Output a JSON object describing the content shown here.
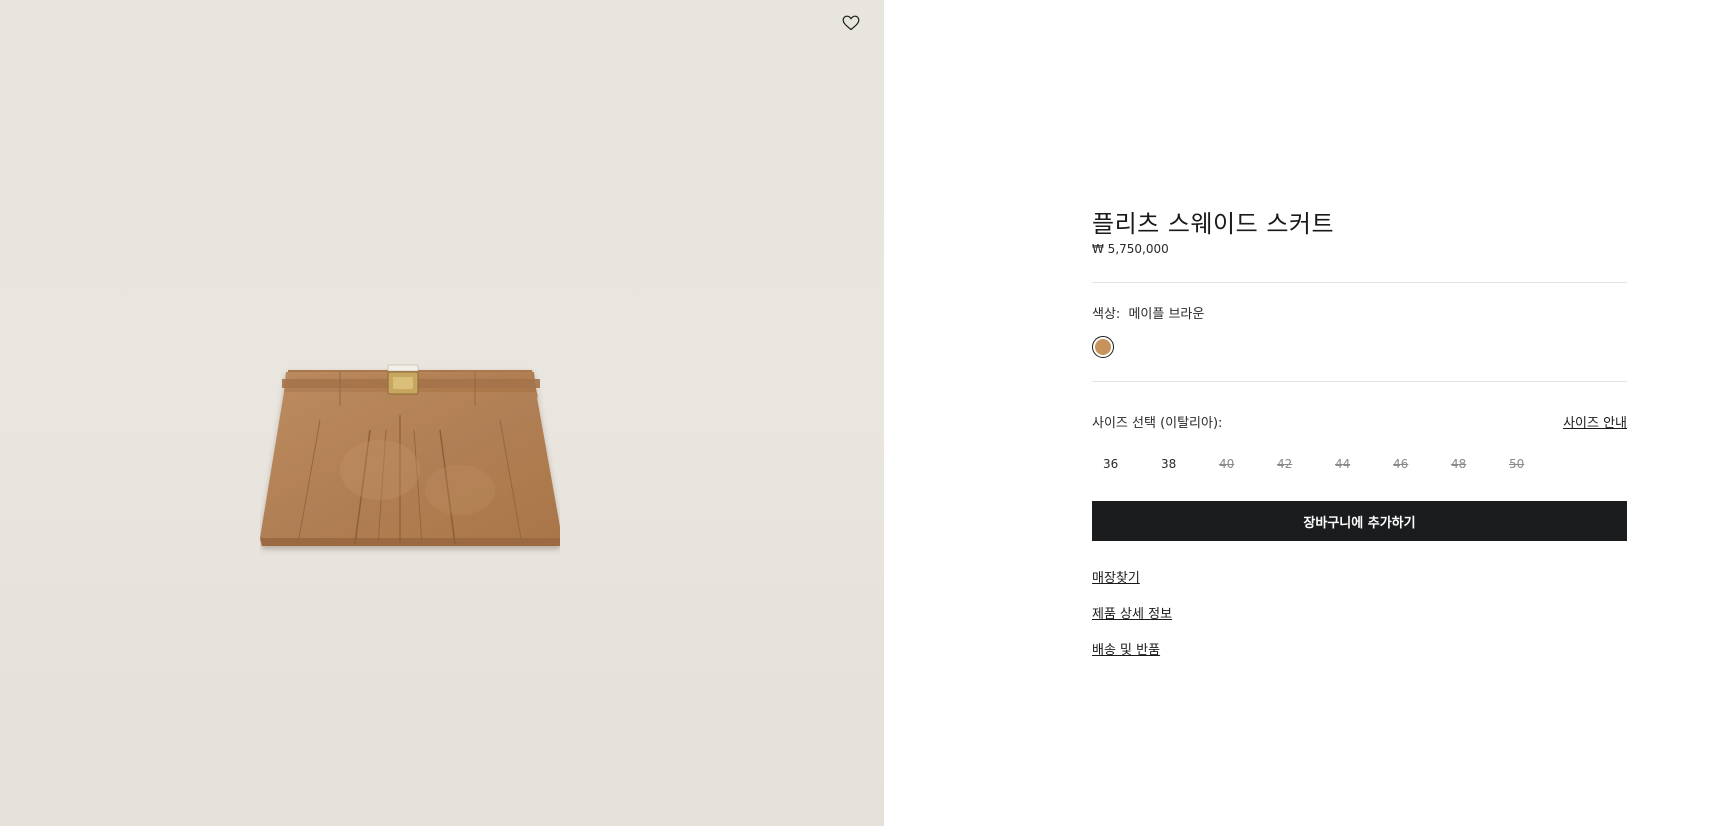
{
  "product": {
    "title": "플리츠 스웨이드 스커트",
    "price": "₩ 5,750,000",
    "image_icon": "suede-pleated-mini-skirt"
  },
  "wishlist": {
    "icon": "heart-outline-icon"
  },
  "color": {
    "label": "색상:",
    "value": "메이플 브라운",
    "swatch_hex": "#c8925b"
  },
  "size": {
    "label": "사이즈 선택 (이탈리아):",
    "guide_label": "사이즈 안내",
    "options": [
      {
        "label": "36",
        "available": true
      },
      {
        "label": "38",
        "available": true
      },
      {
        "label": "40",
        "available": false
      },
      {
        "label": "42",
        "available": false
      },
      {
        "label": "44",
        "available": false
      },
      {
        "label": "46",
        "available": false
      },
      {
        "label": "48",
        "available": false
      },
      {
        "label": "50",
        "available": false
      }
    ]
  },
  "cart": {
    "add_label": "장바구니에 추가하기"
  },
  "links": {
    "store_finder": "매장찾기",
    "product_details": "제품 상세 정보",
    "shipping_returns": "배송 및 반품"
  },
  "colors": {
    "button_bg": "#1b1c1e",
    "image_bg": "#e8e4de",
    "skirt": "#b5855a"
  }
}
